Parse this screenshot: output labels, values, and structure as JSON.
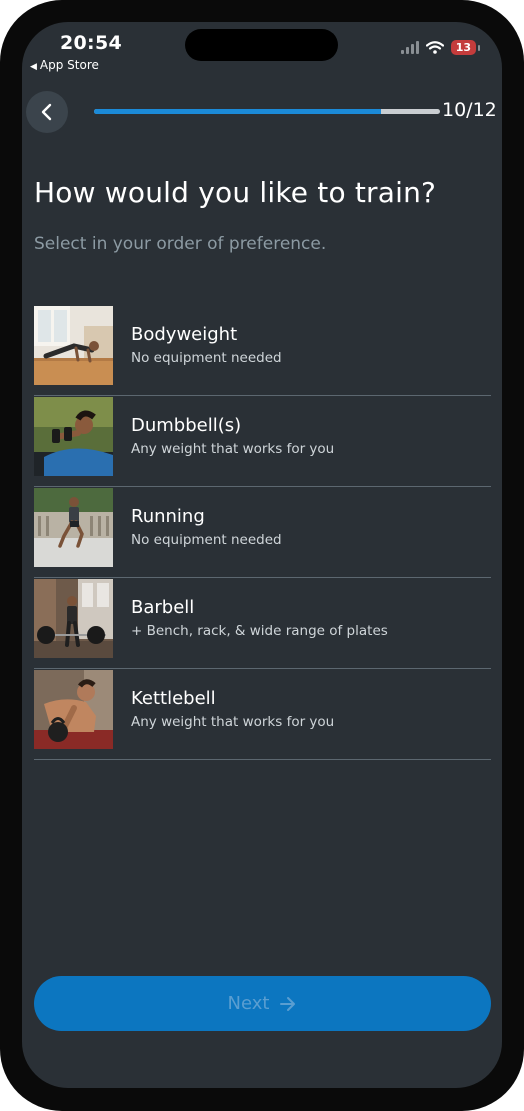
{
  "status_bar": {
    "time": "20:54",
    "back_to_app": "App Store",
    "battery": "13"
  },
  "header": {
    "step": "10/12",
    "progress": 0.83
  },
  "title": "How would you like to train?",
  "subtitle": "Select in your order of preference.",
  "options": [
    {
      "name": "Bodyweight",
      "desc": "No equipment needed"
    },
    {
      "name": "Dumbbell(s)",
      "desc": "Any weight that works for you"
    },
    {
      "name": "Running",
      "desc": "No equipment needed"
    },
    {
      "name": "Barbell",
      "desc": "+ Bench, rack, & wide range of plates"
    },
    {
      "name": "Kettlebell",
      "desc": "Any weight that works for you"
    }
  ],
  "next_button": {
    "label": "Next"
  },
  "colors": {
    "background": "#2a3036",
    "accent": "#1b8ad8",
    "button": "#0c76c0"
  }
}
